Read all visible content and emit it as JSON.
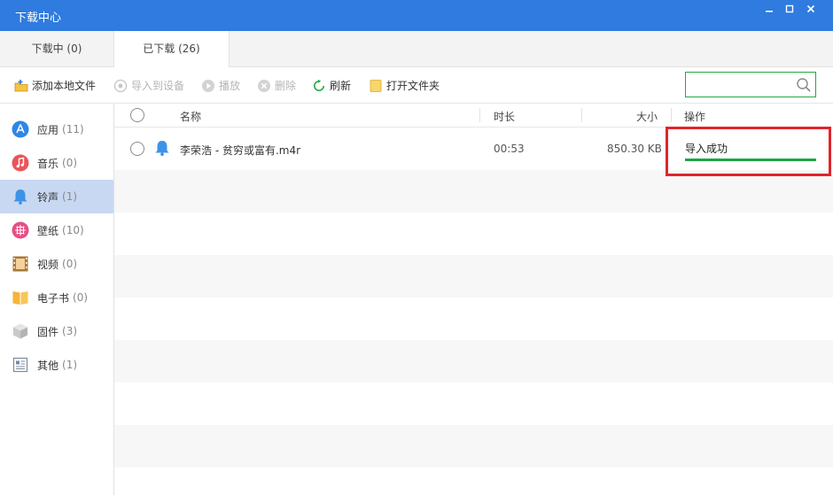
{
  "window": {
    "title": "下载中心",
    "controls": [
      "minimize",
      "maximize",
      "close"
    ]
  },
  "tabs": [
    {
      "label": "下载中 (0)",
      "active": false
    },
    {
      "label": "已下载 (26)",
      "active": true
    }
  ],
  "toolbar": {
    "add_local": "添加本地文件",
    "import_device": "导入到设备",
    "play": "播放",
    "delete": "删除",
    "refresh": "刷新",
    "open_folder": "打开文件夹",
    "search_placeholder": ""
  },
  "sidebar": {
    "items": [
      {
        "label": "应用",
        "count": "(11)",
        "icon": "app-store-icon",
        "color": "#2f86e6"
      },
      {
        "label": "音乐",
        "count": "(0)",
        "icon": "music-note-icon",
        "color": "#e9555a"
      },
      {
        "label": "铃声",
        "count": "(1)",
        "icon": "bell-icon",
        "color": "#3d93e8",
        "active": true
      },
      {
        "label": "壁纸",
        "count": "(10)",
        "icon": "wallpaper-icon",
        "color": "#e64f86"
      },
      {
        "label": "视频",
        "count": "(0)",
        "icon": "film-icon",
        "color": "#a8793b"
      },
      {
        "label": "电子书",
        "count": "(0)",
        "icon": "book-icon",
        "color": "#f5b43a"
      },
      {
        "label": "固件",
        "count": "(3)",
        "icon": "firmware-box-icon",
        "color": "#c9c9c9"
      },
      {
        "label": "其他",
        "count": "(1)",
        "icon": "document-icon",
        "color": "#7a8aa0"
      }
    ]
  },
  "table": {
    "columns": {
      "name": "名称",
      "duration": "时长",
      "size": "大小",
      "action": "操作"
    },
    "rows": [
      {
        "name": "李荣浩 - 贫穷或富有.m4r",
        "duration": "00:53",
        "size": "850.30 KB",
        "status": "导入成功",
        "progress": 1.0
      }
    ]
  },
  "colors": {
    "titlebar": "#2f7bdf",
    "active_sidebar": "#c8d8f2",
    "progress": "#1fa547",
    "highlight_box": "#e0242b",
    "search_border": "#28a745",
    "stripe": "#f7f7f7"
  }
}
